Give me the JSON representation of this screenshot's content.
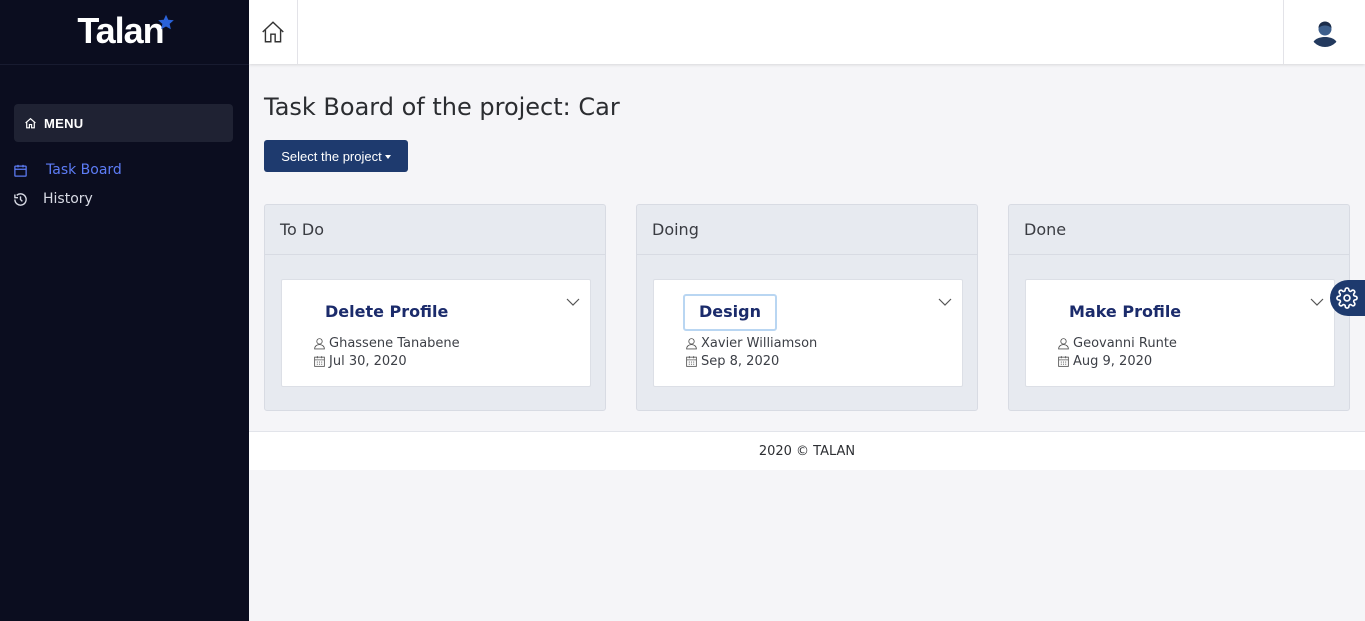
{
  "brand": {
    "name": "Talan"
  },
  "sidebar": {
    "menu_label": "MENU",
    "items": [
      {
        "label": "Task Board",
        "icon": "calendar-icon",
        "active": true
      },
      {
        "label": "History",
        "icon": "history-icon",
        "active": false
      }
    ]
  },
  "header": {
    "home_icon": "home-icon",
    "avatar_icon": "user-avatar"
  },
  "page": {
    "title": "Task Board of the project: Car",
    "select_button": "Select the project"
  },
  "board": {
    "columns": [
      {
        "title": "To Do",
        "card": {
          "title": "Delete Profile",
          "assignee": "Ghassene Tanabene",
          "date": "Jul 30, 2020"
        }
      },
      {
        "title": "Doing",
        "card": {
          "title": "Design",
          "assignee": "Xavier Williamson",
          "date": "Sep 8, 2020"
        }
      },
      {
        "title": "Done",
        "card": {
          "title": "Make Profile",
          "assignee": "Geovanni Runte",
          "date": "Aug 9, 2020"
        }
      }
    ]
  },
  "footer": {
    "text": "2020 © TALAN"
  },
  "colors": {
    "sidebar_bg": "#0b0d1f",
    "accent": "#1e3a6e",
    "active_link": "#5d7cf6",
    "card_title": "#1b2b6b"
  }
}
